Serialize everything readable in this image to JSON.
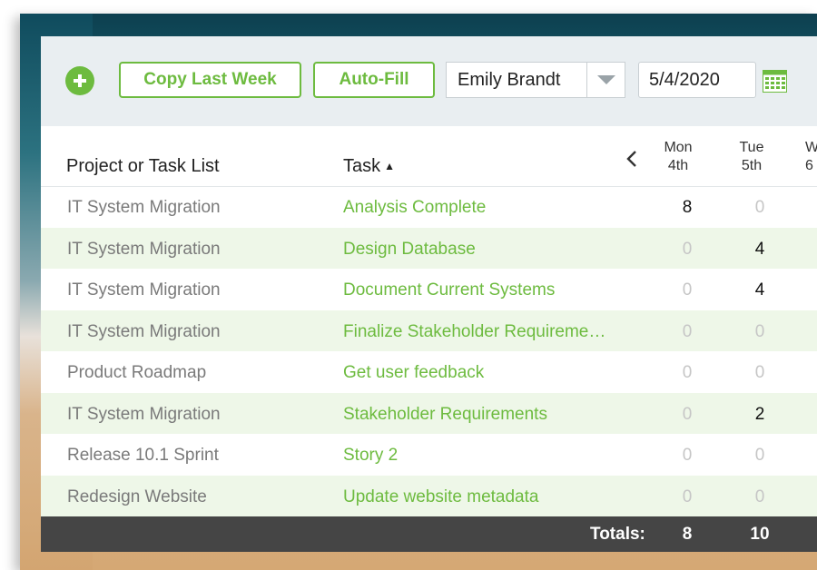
{
  "toolbar": {
    "copy_last_week_label": "Copy Last Week",
    "auto_fill_label": "Auto-Fill",
    "user_select_value": "Emily Brandt",
    "date_value": "5/4/2020"
  },
  "header": {
    "project_col": "Project or Task List",
    "task_col": "Task",
    "task_sort": "▲",
    "days": [
      {
        "name": "Mon",
        "date": "4th"
      },
      {
        "name": "Tue",
        "date": "5th"
      },
      {
        "name": "W",
        "date": "6"
      }
    ]
  },
  "rows": [
    {
      "project": "IT System Migration",
      "task": "Analysis Complete",
      "mon": "8",
      "tue": "0"
    },
    {
      "project": "IT System Migration",
      "task": "Design Database",
      "mon": "0",
      "tue": "4"
    },
    {
      "project": "IT System Migration",
      "task": "Document Current Systems",
      "mon": "0",
      "tue": "4"
    },
    {
      "project": "IT System Migration",
      "task": "Finalize Stakeholder Requireme…",
      "mon": "0",
      "tue": "0"
    },
    {
      "project": "Product Roadmap",
      "task": "Get user feedback",
      "mon": "0",
      "tue": "0"
    },
    {
      "project": "IT System Migration",
      "task": "Stakeholder Requirements",
      "mon": "0",
      "tue": "2"
    },
    {
      "project": "Release 10.1 Sprint",
      "task": "Story 2",
      "mon": "0",
      "tue": "0"
    },
    {
      "project": "Redesign Website",
      "task": "Update website metadata",
      "mon": "0",
      "tue": "0"
    }
  ],
  "totals": {
    "label": "Totals:",
    "mon": "8",
    "tue": "10"
  },
  "colors": {
    "accent": "#6dbb3f",
    "row_alt": "#eef7e8",
    "totals_bg": "#454545",
    "toolbar_bg": "#e9eef1"
  },
  "icons": [
    "plus-circle-icon",
    "chevron-down-icon",
    "calendar-icon",
    "chevron-left-icon",
    "sort-asc-icon"
  ]
}
